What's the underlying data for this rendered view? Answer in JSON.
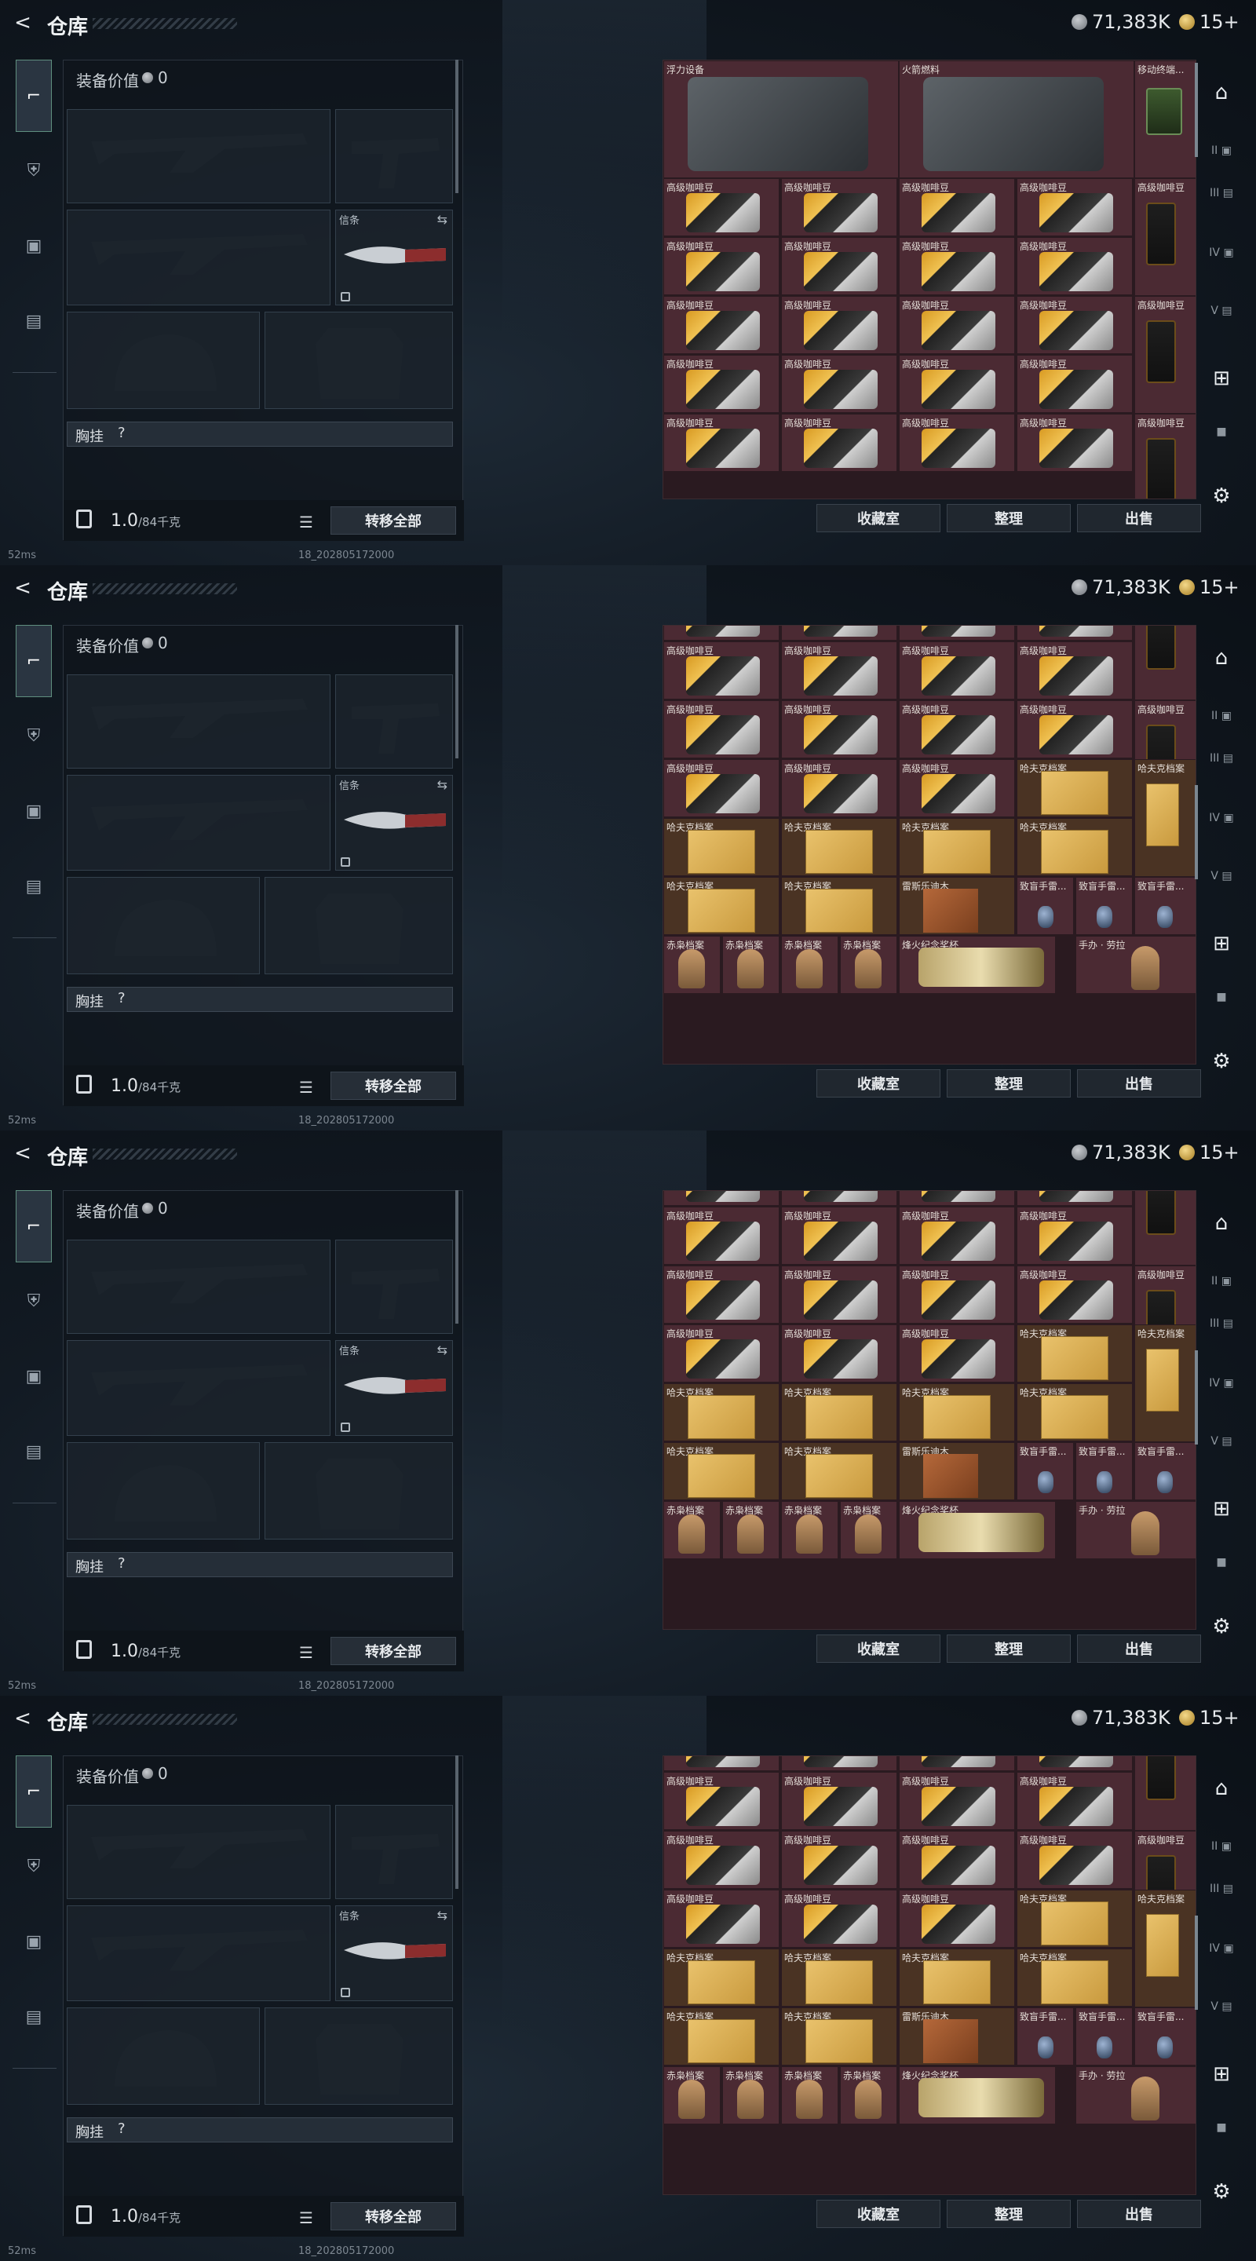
{
  "header": {
    "back_label": "<",
    "title": "仓库",
    "currency1": "71,383K",
    "currency2": "15+"
  },
  "sidebar": {
    "items": [
      "weapon-tab",
      "armor-tab",
      "bag-tab",
      "case-tab"
    ]
  },
  "equipment": {
    "value_label": "装备价值",
    "value": "0",
    "knife_label": "信条",
    "chest_label": "胸挂",
    "chest_hint": "?",
    "weight": "1.0",
    "weight_unit": "/84千克",
    "transfer_all": "转移全部"
  },
  "stash": {
    "buttons": [
      "收藏室",
      "整理",
      "出售"
    ],
    "labels": {
      "coffee": "高级咖啡豆",
      "folder": "哈夫克档案",
      "wood": "雷斯乐迪木",
      "grenade": "致盲手雷...",
      "cradle": "赤枭档案",
      "trophy": "烽火纪念奖杯",
      "figure": "手办 · 劳拉",
      "float": "浮力设备",
      "fuel": "火箭燃料",
      "monitor": "移动终端..."
    }
  },
  "footer": {
    "ping": "52ms",
    "build": "18_202805172000"
  }
}
